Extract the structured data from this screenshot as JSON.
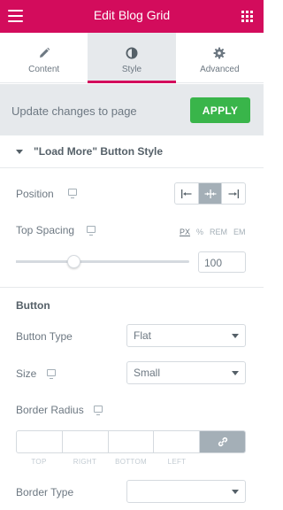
{
  "header": {
    "title": "Edit Blog Grid",
    "menu_icon": "hamburger-icon",
    "apps_icon": "grid-icon"
  },
  "tabs": [
    {
      "label": "Content",
      "icon": "pencil-icon",
      "active": false
    },
    {
      "label": "Style",
      "icon": "contrast-icon",
      "active": true
    },
    {
      "label": "Advanced",
      "icon": "gear-icon",
      "active": false
    }
  ],
  "update_bar": {
    "text": "Update changes to page",
    "apply_label": "APPLY"
  },
  "section": {
    "title": "\"Load More\" Button Style"
  },
  "position": {
    "label": "Position",
    "options": [
      "align-left",
      "align-center",
      "align-right"
    ],
    "selected": "align-center"
  },
  "top_spacing": {
    "label": "Top Spacing",
    "units": [
      "PX",
      "%",
      "REM",
      "EM"
    ],
    "active_unit": "PX",
    "value": "100",
    "slider_fraction": 0.33
  },
  "button_group": {
    "title": "Button"
  },
  "button_type": {
    "label": "Button Type",
    "value": "Flat"
  },
  "size": {
    "label": "Size",
    "value": "Small"
  },
  "border_radius": {
    "label": "Border Radius",
    "fields": [
      "TOP",
      "RIGHT",
      "BOTTOM",
      "LEFT"
    ]
  },
  "border_type": {
    "label": "Border Type",
    "value": ""
  },
  "colors": {
    "brand": "#d30c5c",
    "apply": "#39b54a",
    "panel": "#e6e9ec"
  }
}
